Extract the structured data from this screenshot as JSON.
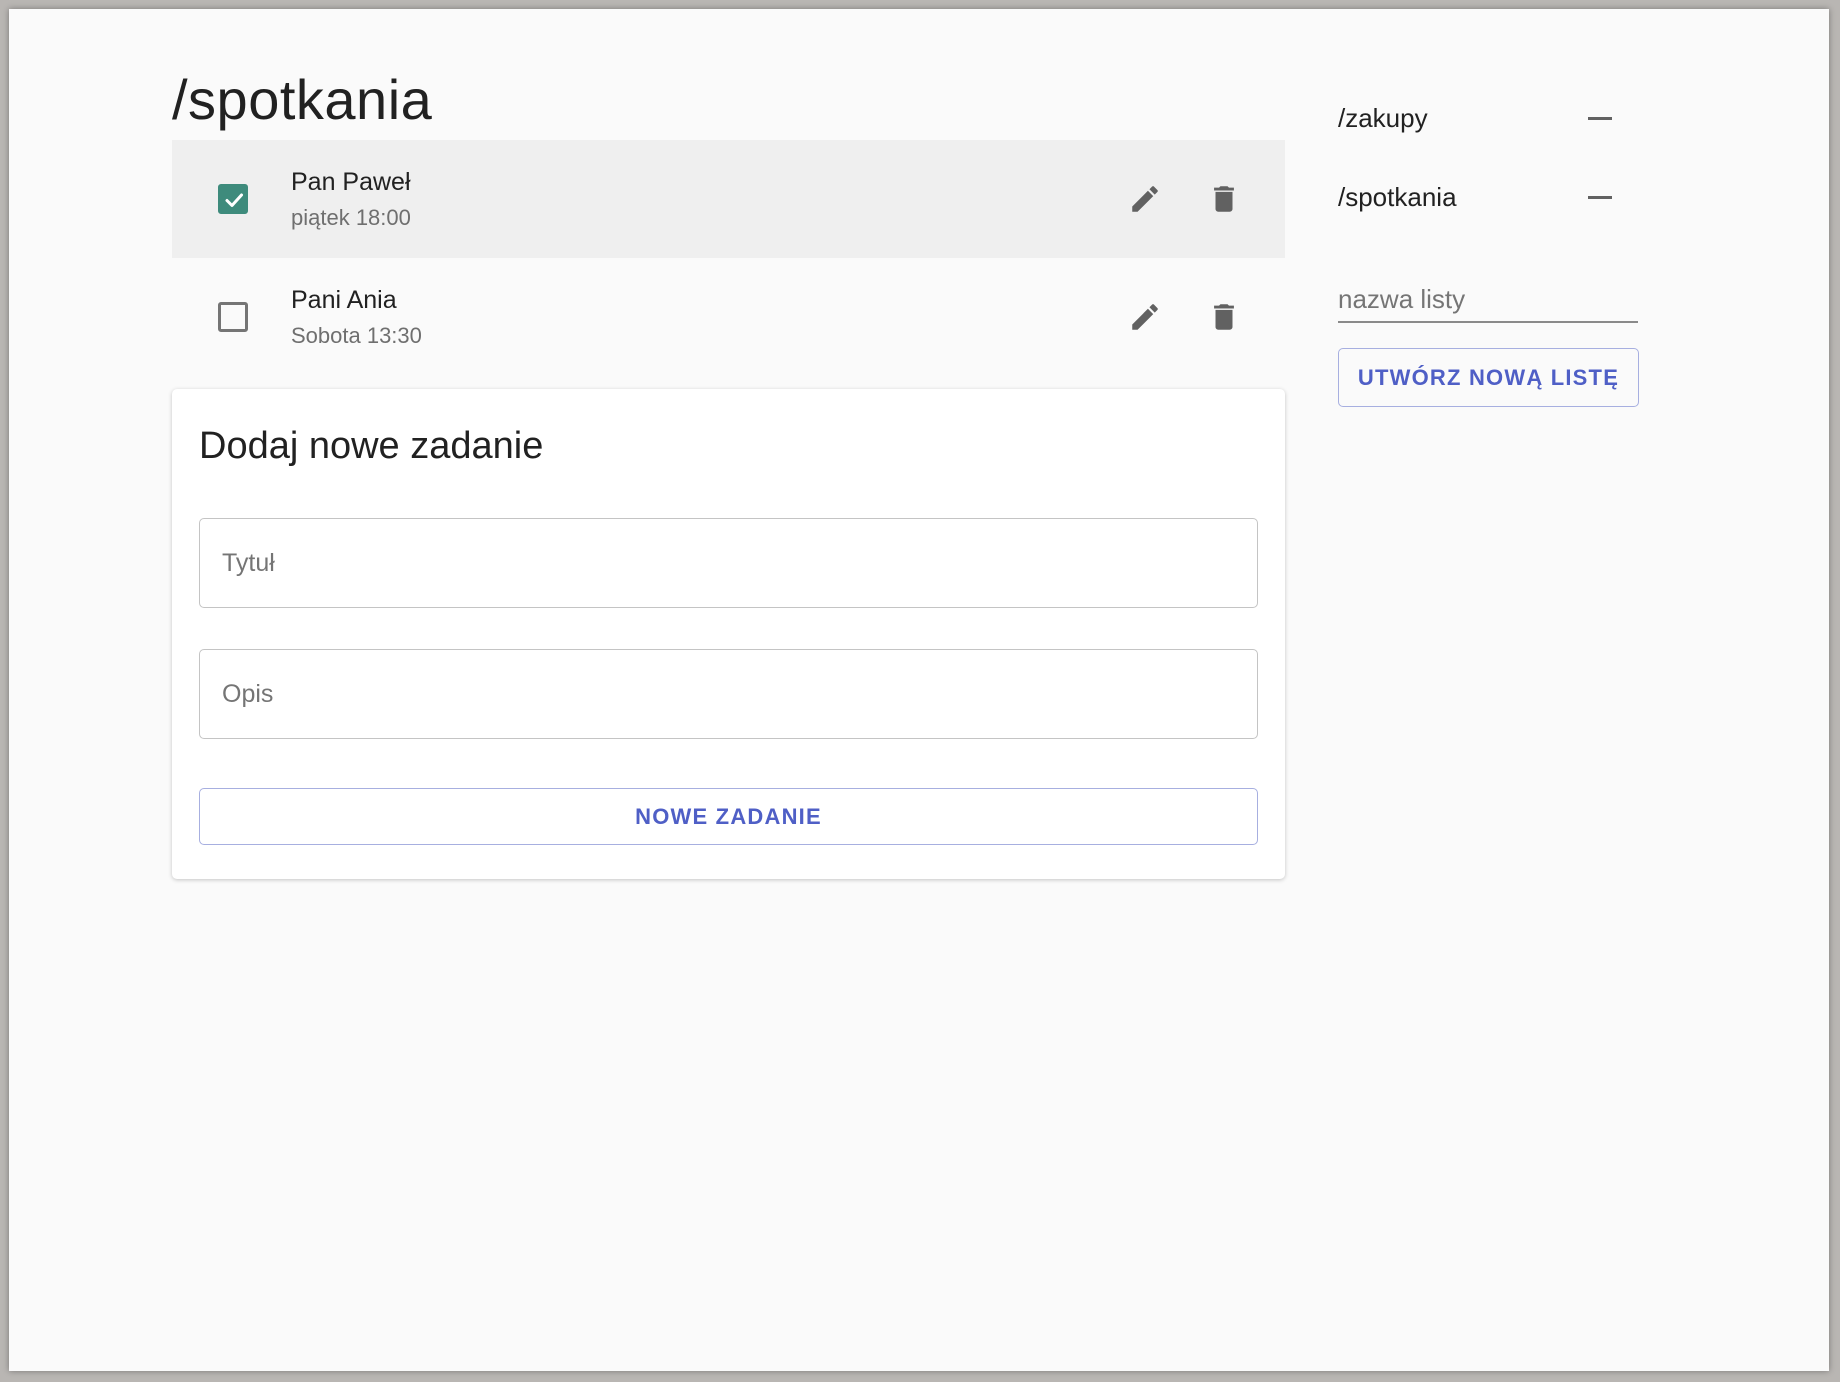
{
  "page": {
    "title": "/spotkania"
  },
  "tasks": [
    {
      "title": "Pan Paweł",
      "subtitle": "piątek 18:00",
      "done": true,
      "selected": true
    },
    {
      "title": "Pani Ania",
      "subtitle": "Sobota 13:30",
      "done": false,
      "selected": false
    }
  ],
  "new_task": {
    "heading": "Dodaj nowe zadanie",
    "title_placeholder": "Tytuł",
    "description_placeholder": "Opis",
    "button_label": "NOWE ZADANIE"
  },
  "sidebar": {
    "lists": [
      {
        "label": "/zakupy"
      },
      {
        "label": "/spotkania"
      }
    ],
    "list_name_placeholder": "nazwa listy",
    "create_button_label": "UTWÓRZ NOWĄ LISTĘ"
  },
  "colors": {
    "accent": "#4f5fc6",
    "checkbox_checked": "#3e8b7c",
    "selected_row": "#efefef",
    "icon": "#616161"
  },
  "icons": {
    "edit": "pencil-icon",
    "delete": "trash-icon",
    "remove_list": "minus-icon",
    "checked": "checkmark-icon"
  }
}
